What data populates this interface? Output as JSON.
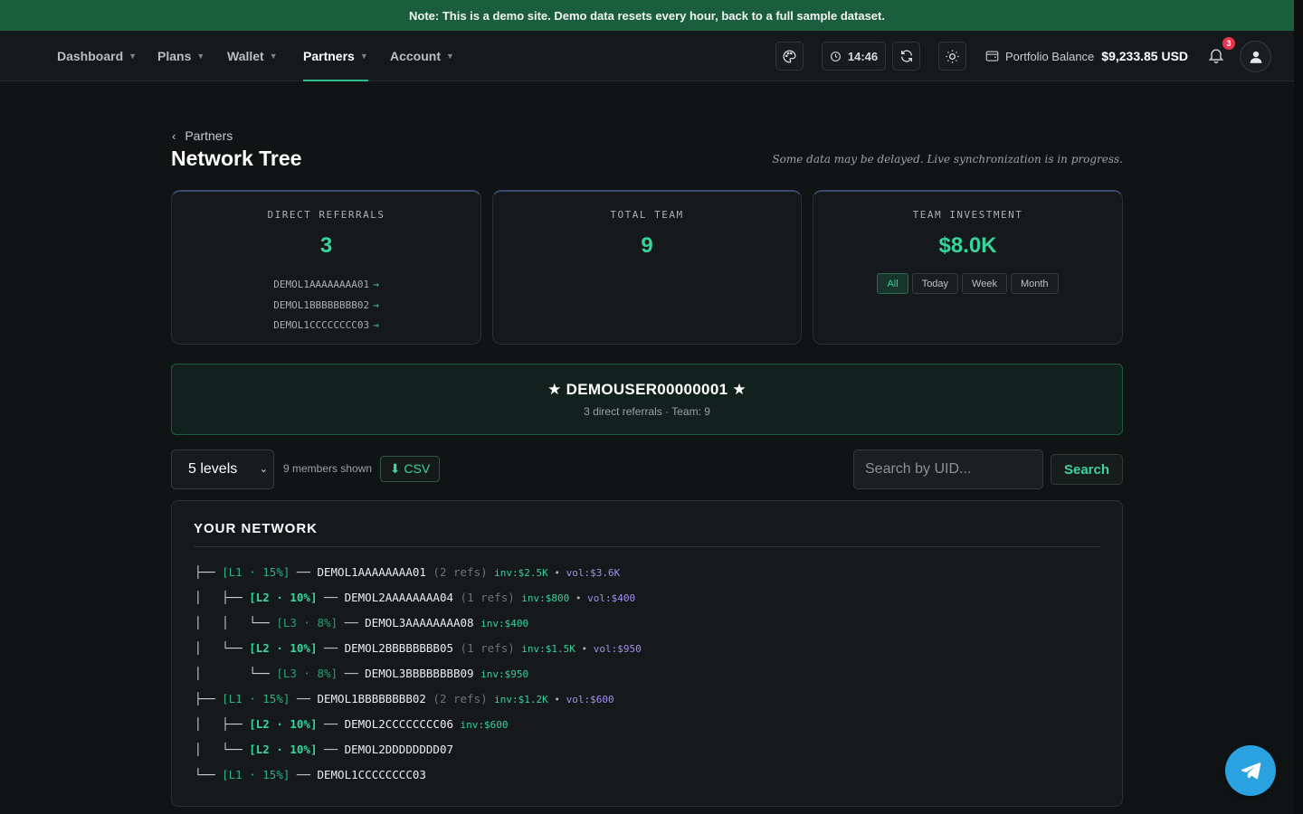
{
  "notice": "Note: This is a demo site. Demo data resets every hour, back to a full sample dataset.",
  "nav": {
    "items": [
      {
        "label": "Dashboard"
      },
      {
        "label": "Plans"
      },
      {
        "label": "Wallet"
      },
      {
        "label": "Partners",
        "active": true
      },
      {
        "label": "Account"
      }
    ],
    "time": "14:46",
    "balance_label": "Portfolio Balance",
    "balance_value": "$9,233.85 USD",
    "notification_count": "3",
    "icons": [
      "palette-icon",
      "clock-icon",
      "refresh-icon",
      "sun-icon",
      "wallet-icon",
      "bell-icon",
      "user-icon"
    ]
  },
  "page": {
    "back_label": "Partners",
    "title": "Network Tree",
    "sync_note": "Some data may be delayed. Live synchronization is in progress."
  },
  "stats": {
    "direct_referrals": {
      "label": "DIRECT REFERRALS",
      "value": "3",
      "list": [
        "DEMOL1AAAAAAAA01",
        "DEMOL1BBBBBBBB02",
        "DEMOL1CCCCCCCC03"
      ],
      "arrow": "→"
    },
    "total_team": {
      "label": "TOTAL TEAM",
      "value": "9"
    },
    "team_investment": {
      "label": "TEAM INVESTMENT",
      "value": "$8.0K",
      "filters": [
        "All",
        "Today",
        "Week",
        "Month"
      ],
      "active_filter": "All"
    }
  },
  "hero": {
    "name": "★ DEMOUSER00000001 ★",
    "sub": "3 direct referrals · Team: 9"
  },
  "controls": {
    "levels_value": "5 levels",
    "members_shown": "9 members shown",
    "csv_label": "⬇ CSV",
    "search_placeholder": "Search by UID...",
    "search_label": "Search"
  },
  "network": {
    "title": "YOUR NETWORK",
    "rows": [
      {
        "prefix": "├── ",
        "level": "[L1 · 15%]",
        "lvl": 1,
        "sep": " ── ",
        "uid": "DEMOL1AAAAAAAA01",
        "refs": " (2 refs)",
        "inv": "inv:$2.5K",
        "vol": "vol:$3.6K"
      },
      {
        "prefix": "│   ├── ",
        "level": "[L2 · 10%]",
        "lvl": 2,
        "sep": " ── ",
        "uid": "DEMOL2AAAAAAAA04",
        "refs": " (1 refs)",
        "inv": "inv:$800",
        "vol": "vol:$400"
      },
      {
        "prefix": "│   │   └── ",
        "level": "[L3 · 8%]",
        "lvl": 3,
        "sep": " ── ",
        "uid": "DEMOL3AAAAAAAA08",
        "refs": "",
        "inv": "inv:$400",
        "vol": ""
      },
      {
        "prefix": "│   └── ",
        "level": "[L2 · 10%]",
        "lvl": 2,
        "sep": " ── ",
        "uid": "DEMOL2BBBBBBBB05",
        "refs": " (1 refs)",
        "inv": "inv:$1.5K",
        "vol": "vol:$950"
      },
      {
        "prefix": "│       └── ",
        "level": "[L3 · 8%]",
        "lvl": 3,
        "sep": " ── ",
        "uid": "DEMOL3BBBBBBBB09",
        "refs": "",
        "inv": "inv:$950",
        "vol": ""
      },
      {
        "prefix": "├── ",
        "level": "[L1 · 15%]",
        "lvl": 1,
        "sep": " ── ",
        "uid": "DEMOL1BBBBBBBB02",
        "refs": " (2 refs)",
        "inv": "inv:$1.2K",
        "vol": "vol:$600"
      },
      {
        "prefix": "│   ├── ",
        "level": "[L2 · 10%]",
        "lvl": 2,
        "sep": " ── ",
        "uid": "DEMOL2CCCCCCCC06",
        "refs": "",
        "inv": "inv:$600",
        "vol": ""
      },
      {
        "prefix": "│   └── ",
        "level": "[L2 · 10%]",
        "lvl": 2,
        "sep": " ── ",
        "uid": "DEMOL2DDDDDDDD07",
        "refs": "",
        "inv": "",
        "vol": ""
      },
      {
        "prefix": "└── ",
        "level": "[L1 · 15%]",
        "lvl": 1,
        "sep": " ── ",
        "uid": "DEMOL1CCCCCCCC03",
        "refs": "",
        "inv": "",
        "vol": ""
      }
    ]
  },
  "colors": {
    "accent": "#35d49a",
    "notice_bg": "#1a5e3e",
    "volume": "#a28ef0",
    "telegram": "#2aa2e0"
  }
}
